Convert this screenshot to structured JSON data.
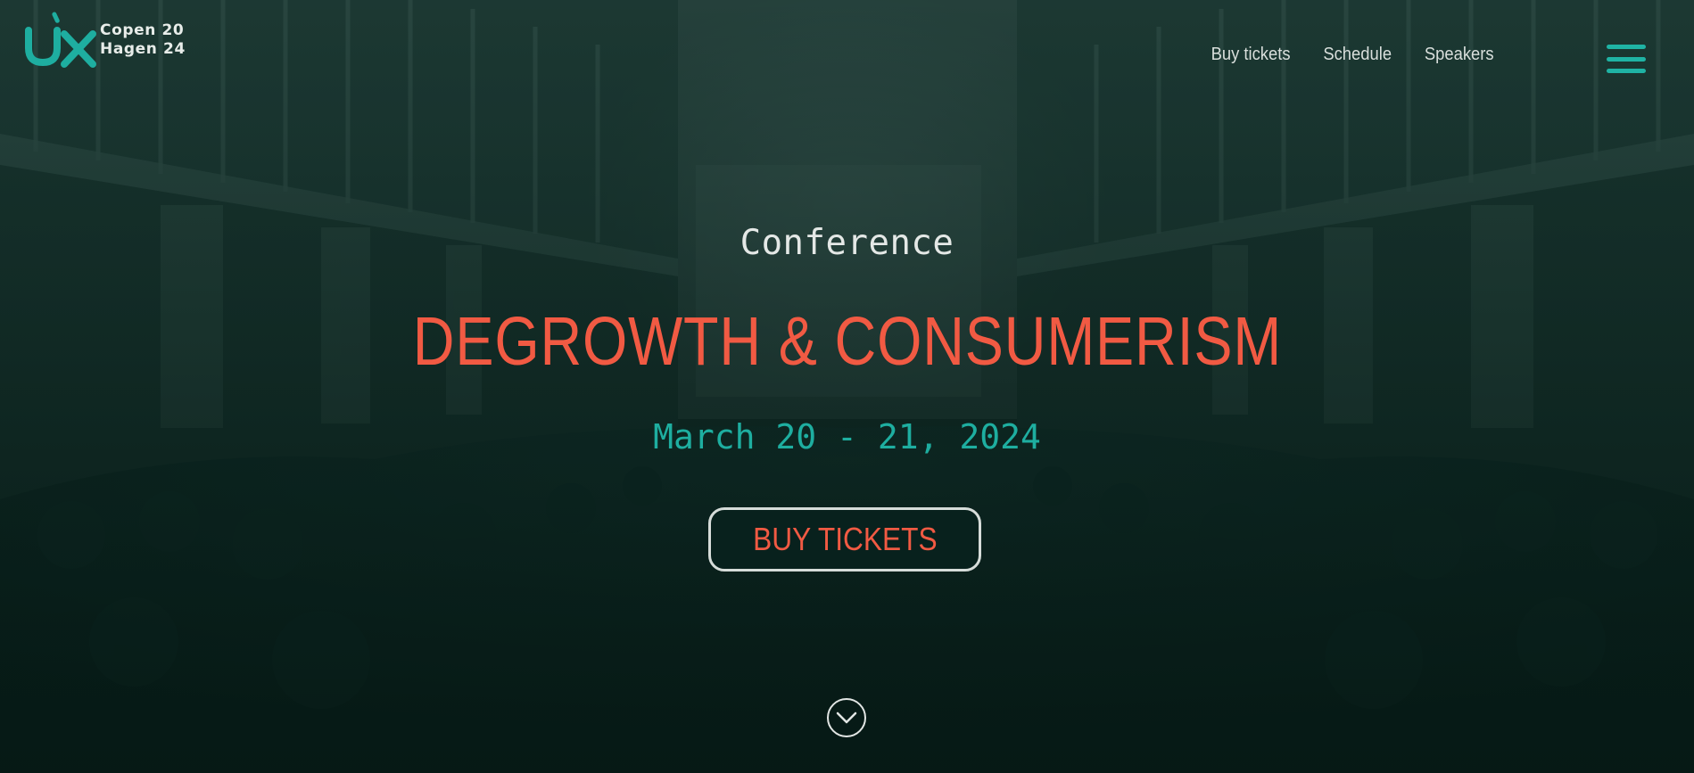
{
  "logo": {
    "mark": "UX",
    "line1": "Copen 20",
    "line2": "Hagen 24"
  },
  "nav": {
    "items": [
      {
        "label": "Buy tickets"
      },
      {
        "label": "Schedule"
      },
      {
        "label": "Speakers"
      }
    ],
    "menu_icon": "hamburger-menu-icon"
  },
  "hero": {
    "subtitle": "Conference",
    "title": "DEGROWTH & CONSUMERISM",
    "dates": "March 20 - 21, 2024",
    "cta_label": "BUY TICKETS",
    "scroll_icon": "chevron-down-circle-icon"
  },
  "colors": {
    "accent_teal": "#1eaea0",
    "accent_coral": "#f15a43",
    "text_light": "#e4e8e6",
    "background": "#0f2823"
  }
}
